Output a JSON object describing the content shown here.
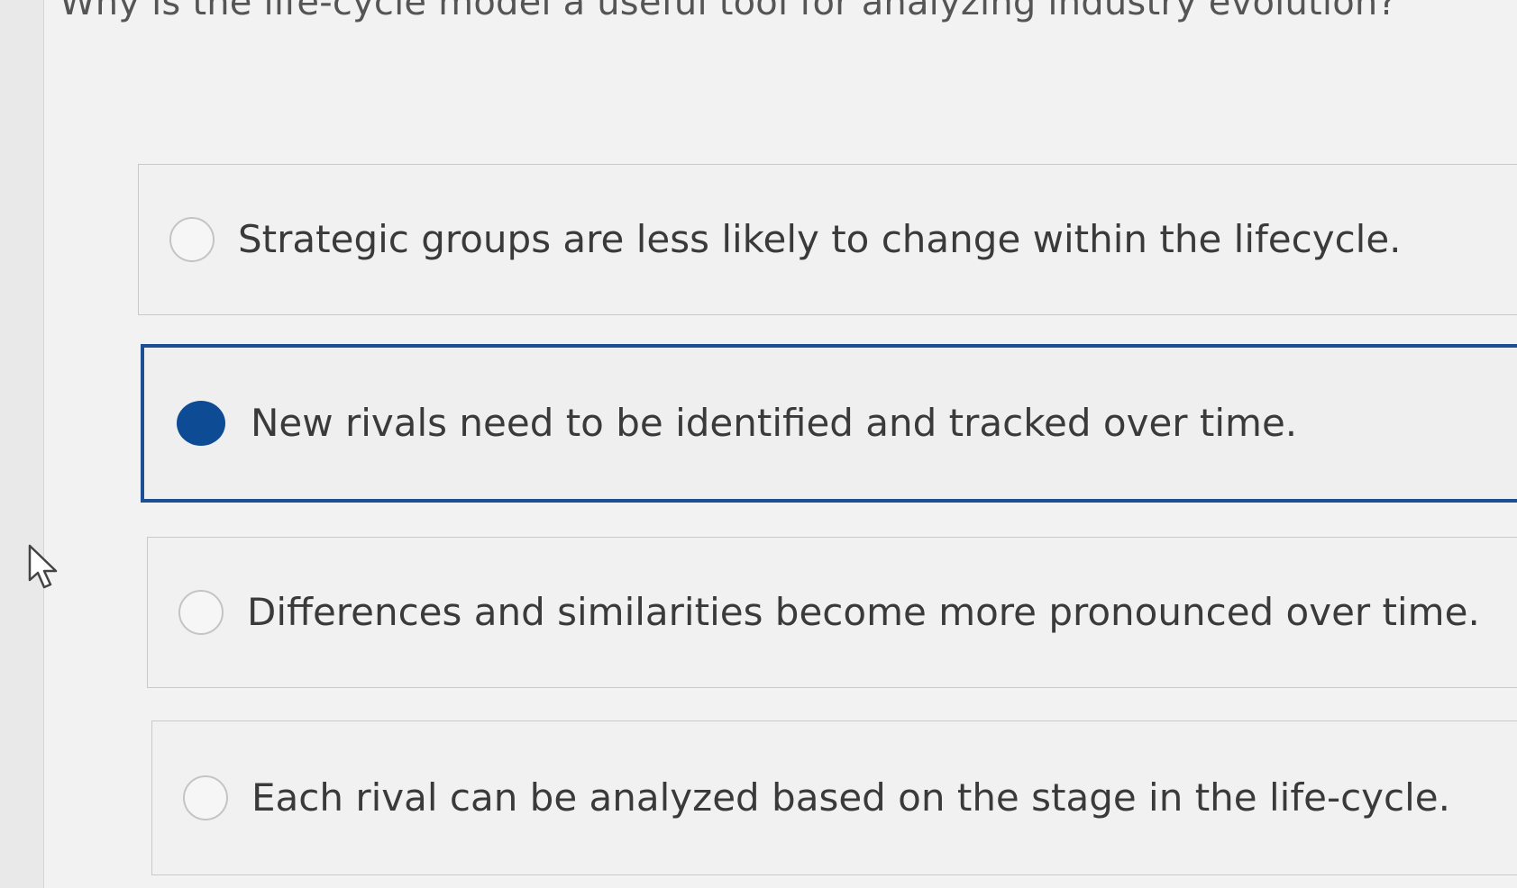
{
  "question": {
    "text": "Why is the life-cycle model a useful tool for analyzing industry evolution?"
  },
  "options": [
    {
      "label": "Strategic groups are less likely to change within the lifecycle.",
      "selected": false
    },
    {
      "label": "New rivals need to be identified and tracked over time.",
      "selected": true
    },
    {
      "label": "Differences and similarities become more pronounced over time.",
      "selected": false
    },
    {
      "label": "Each rival can be analyzed based on the stage in the life-cycle.",
      "selected": false
    }
  ],
  "colors": {
    "selected_accent": "#1d4f94",
    "radio_fill": "#0e4b95",
    "unselected_border": "#c9c9c9"
  },
  "icons": {
    "cursor": "mouse-pointer-icon"
  }
}
